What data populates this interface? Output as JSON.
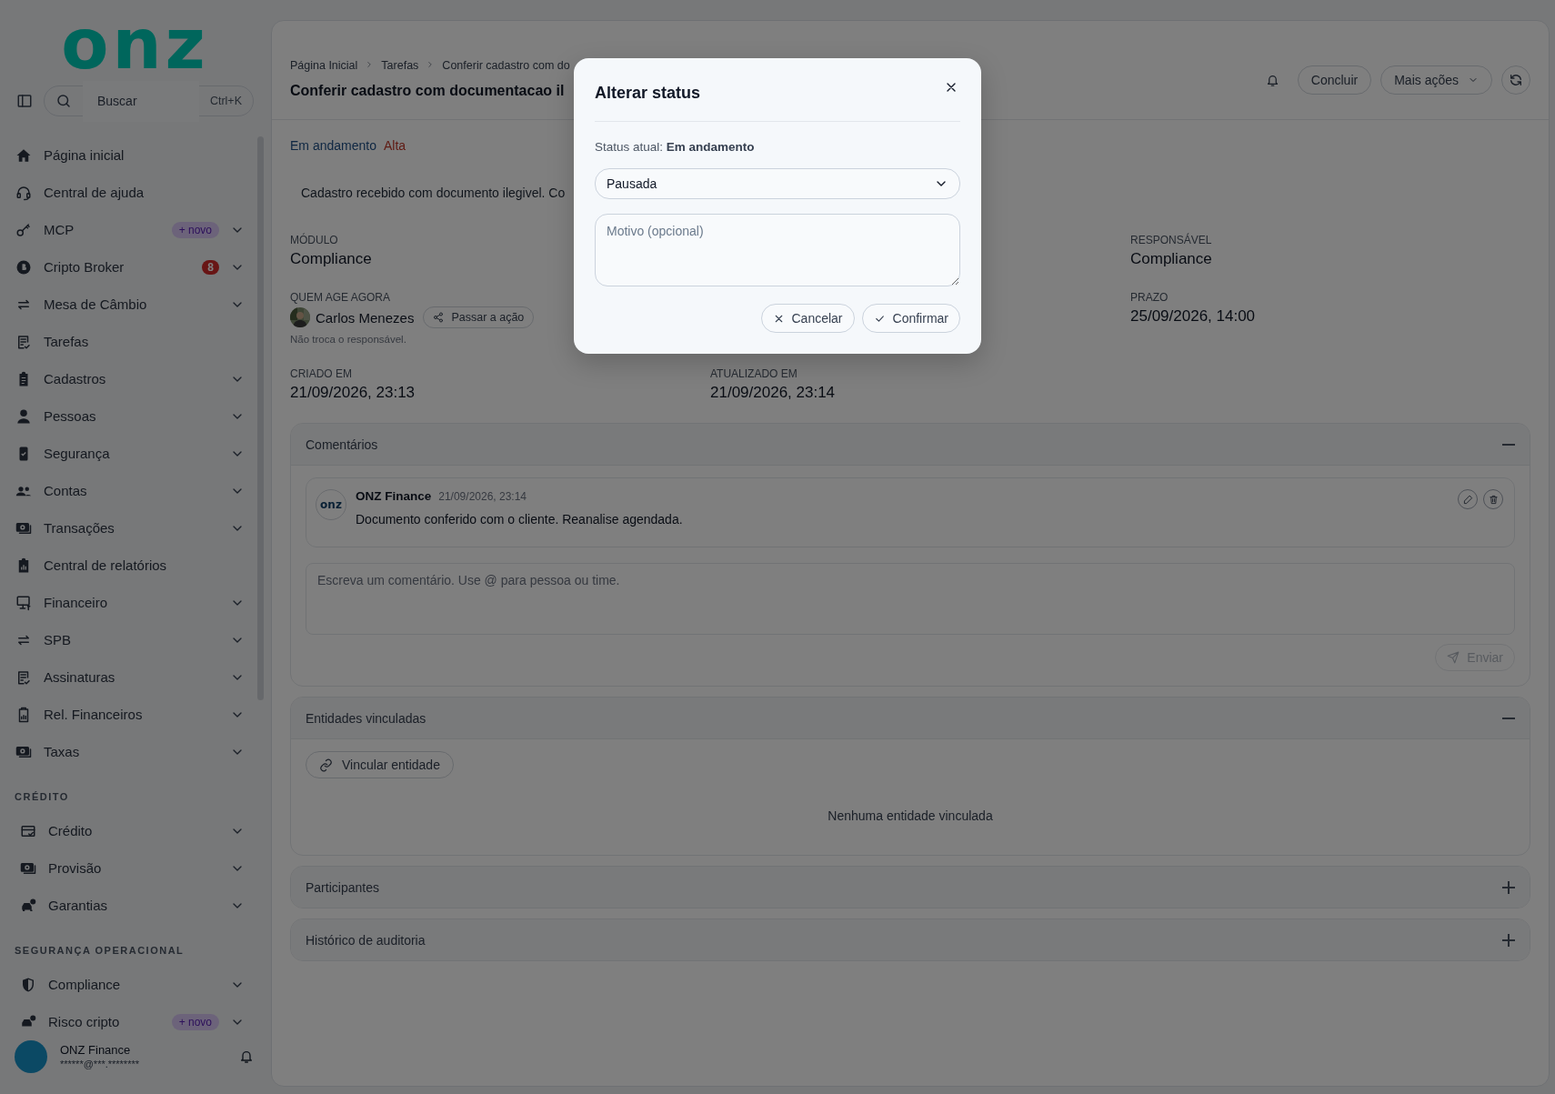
{
  "sidebar": {
    "logo": "onz",
    "search": {
      "placeholder": "Buscar",
      "shortcut": "Ctrl+K"
    },
    "sections": [
      {
        "items": [
          {
            "label": "Página inicial",
            "collapsible": false
          },
          {
            "label": "Central de ajuda",
            "collapsible": false
          },
          {
            "label": "MCP",
            "collapsible": true,
            "badge": {
              "kind": "new",
              "text": "+ novo"
            }
          },
          {
            "label": "Cripto Broker",
            "collapsible": true,
            "badge": {
              "kind": "count",
              "text": "8"
            }
          },
          {
            "label": "Mesa de Câmbio",
            "collapsible": true
          },
          {
            "label": "Tarefas",
            "collapsible": false
          },
          {
            "label": "Cadastros",
            "collapsible": true
          },
          {
            "label": "Pessoas",
            "collapsible": true
          },
          {
            "label": "Segurança",
            "collapsible": true
          },
          {
            "label": "Contas",
            "collapsible": true
          },
          {
            "label": "Transações",
            "collapsible": true
          },
          {
            "label": "Central de relatórios",
            "collapsible": false
          },
          {
            "label": "Financeiro",
            "collapsible": true
          },
          {
            "label": "SPB",
            "collapsible": true
          },
          {
            "label": "Assinaturas",
            "collapsible": true
          },
          {
            "label": "Rel. Financeiros",
            "collapsible": true
          },
          {
            "label": "Taxas",
            "collapsible": true
          }
        ]
      },
      {
        "heading": "CRÉDITO",
        "items": [
          {
            "label": "Crédito",
            "collapsible": true
          },
          {
            "label": "Provisão",
            "collapsible": true
          },
          {
            "label": "Garantias",
            "collapsible": true
          }
        ]
      },
      {
        "heading": "SEGURANÇA OPERACIONAL",
        "items": [
          {
            "label": "Compliance",
            "collapsible": true
          },
          {
            "label": "Risco cripto",
            "collapsible": true,
            "badge": {
              "kind": "new",
              "text": "+ novo"
            }
          }
        ]
      }
    ],
    "user": {
      "name": "ONZ Finance",
      "email": "******@***.********"
    }
  },
  "header": {
    "breadcrumb": [
      "Página Inicial",
      "Tarefas",
      "Conferir cadastro com do"
    ],
    "title": "Conferir cadastro com documentacao il",
    "actions": {
      "complete": "Concluir",
      "more": "Mais ações"
    }
  },
  "task": {
    "status": "Em andamento",
    "priority": "Alta",
    "description": "Cadastro recebido com documento ilegivel. Co",
    "fields": [
      {
        "kind": "text",
        "label": "MÓDULO",
        "value": "Compliance"
      },
      {
        "kind": "text",
        "label": "RESPONSÁVEL",
        "value": "Compliance"
      },
      {
        "kind": "person",
        "label": "QUEM AGE AGORA",
        "value": "Carlos Menezes",
        "action": "Passar a ação",
        "note": "Não troca o responsável."
      },
      {
        "kind": "text",
        "label": "PRAZO",
        "value": "25/09/2026, 14:00"
      },
      {
        "kind": "text",
        "label": "CRIADO EM",
        "value": "21/09/2026, 23:13"
      },
      {
        "kind": "text",
        "label": "ATUALIZADO EM",
        "value": "21/09/2026, 23:14"
      }
    ]
  },
  "panels": [
    {
      "kind": "comments",
      "title": "Comentários",
      "expanded": true,
      "comments": [
        {
          "author": "ONZ Finance",
          "avatar": "onz",
          "time": "21/09/2026, 23:14",
          "text": "Documento conferido com o cliente. Reanalise agendada."
        }
      ],
      "placeholder": "Escreva um comentário. Use @ para pessoa ou time.",
      "send": {
        "label": "Enviar",
        "disabled": true
      }
    },
    {
      "kind": "entities",
      "title": "Entidades vinculadas",
      "expanded": true,
      "button": "Vincular entidade",
      "empty": "Nenhuma entidade vinculada"
    },
    {
      "title": "Participantes",
      "expanded": false
    },
    {
      "title": "Histórico de auditoria",
      "expanded": false
    }
  ],
  "modal": {
    "title": "Alterar status",
    "current": "Status atual: **Em andamento**",
    "select_value": "Pausada",
    "reason_placeholder": "Motivo (opcional)",
    "cancel": "Cancelar",
    "confirm": "Confirmar"
  }
}
